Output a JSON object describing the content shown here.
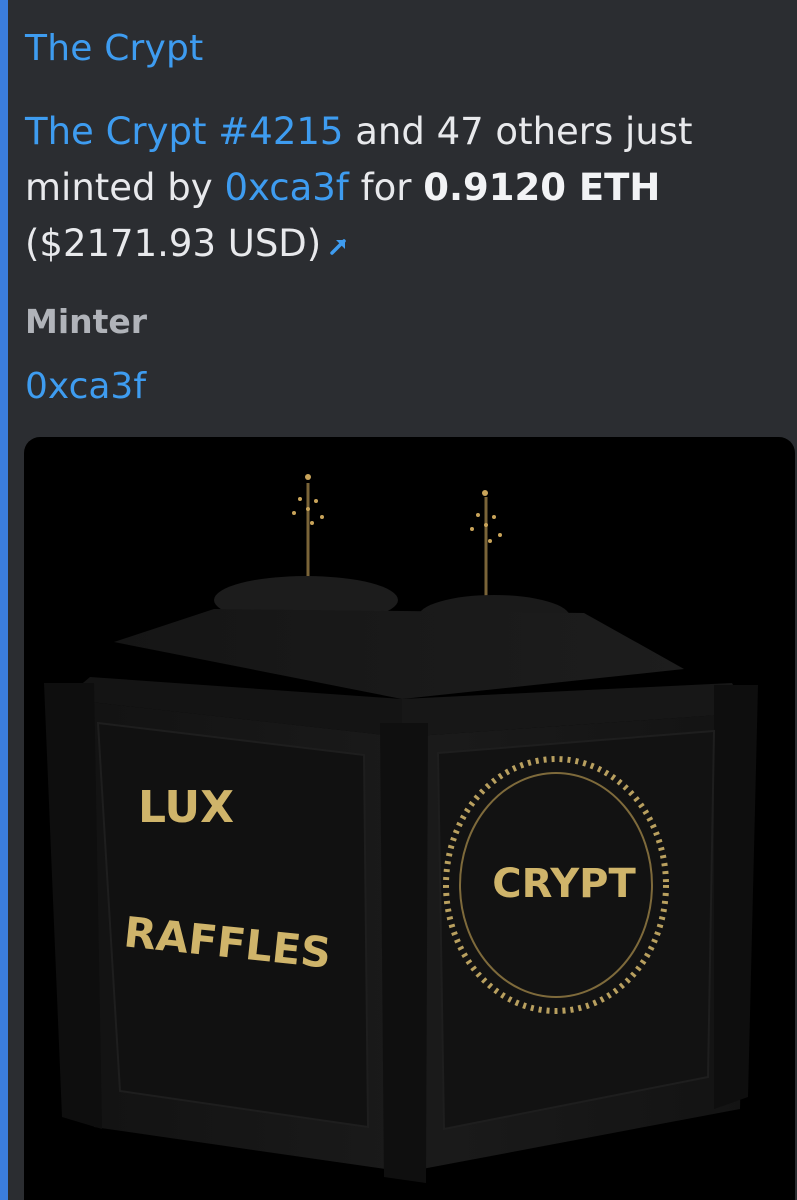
{
  "embed": {
    "accent_color": "#3b7ddd",
    "title": "The Crypt",
    "description": {
      "item_link": "The Crypt #4215",
      "text_1": " and 47 others just minted by ",
      "minter_link": "0xca3f",
      "text_2": " for ",
      "price": "0.9120 ETH",
      "usd": " ($2171.93 USD)",
      "link_icon": "external-link-arrow-icon"
    },
    "field": {
      "name": "Minter",
      "value": "0xca3f"
    },
    "image": {
      "left_face_text_1": "LUX",
      "left_face_text_2": "RAFFLES",
      "right_face_text": "CRYPT"
    }
  }
}
